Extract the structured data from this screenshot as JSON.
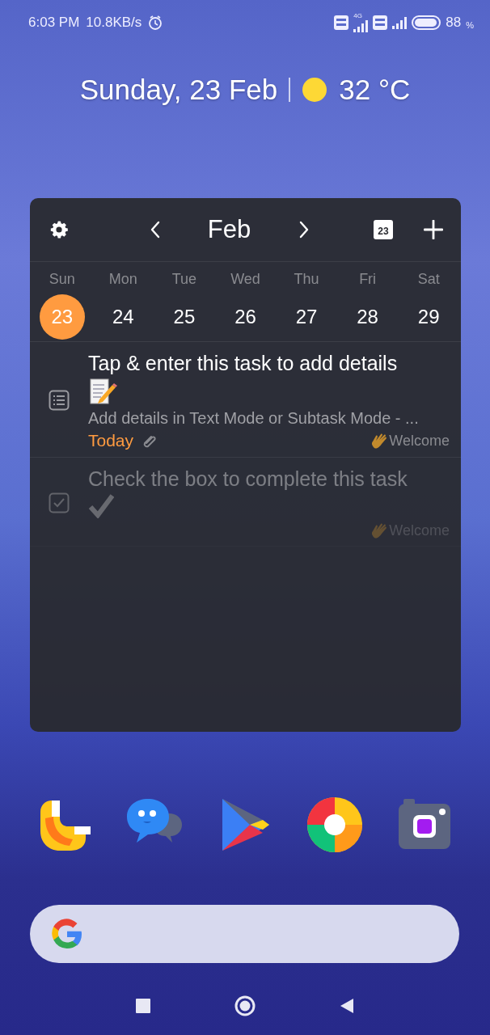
{
  "status_bar": {
    "time": "6:03 PM",
    "speed": "10.8KB/s",
    "network": "4G",
    "battery": "88",
    "battery_unit": "%"
  },
  "date_line": {
    "date": "Sunday, 23 Feb",
    "temperature": "32 °C"
  },
  "widget": {
    "month": "Feb",
    "calendar_badge": "23",
    "weekdays": [
      "Sun",
      "Mon",
      "Tue",
      "Wed",
      "Thu",
      "Fri",
      "Sat"
    ],
    "dates": [
      {
        "label": "23",
        "selected": true
      },
      {
        "label": "24",
        "selected": false
      },
      {
        "label": "25",
        "selected": false
      },
      {
        "label": "26",
        "selected": false
      },
      {
        "label": "27",
        "selected": false
      },
      {
        "label": "28",
        "selected": false
      },
      {
        "label": "29",
        "selected": false
      }
    ],
    "tasks": [
      {
        "kind": "note",
        "title": "Tap & enter this task to add details",
        "subtitle": "Add details in Text Mode or Subtask Mode - ...",
        "due": "Today",
        "attachment": true,
        "tag": "Welcome",
        "dimmed": false
      },
      {
        "kind": "checkbox",
        "title": "Check the box to complete this task",
        "tag": "Welcome",
        "dimmed": true
      }
    ]
  }
}
